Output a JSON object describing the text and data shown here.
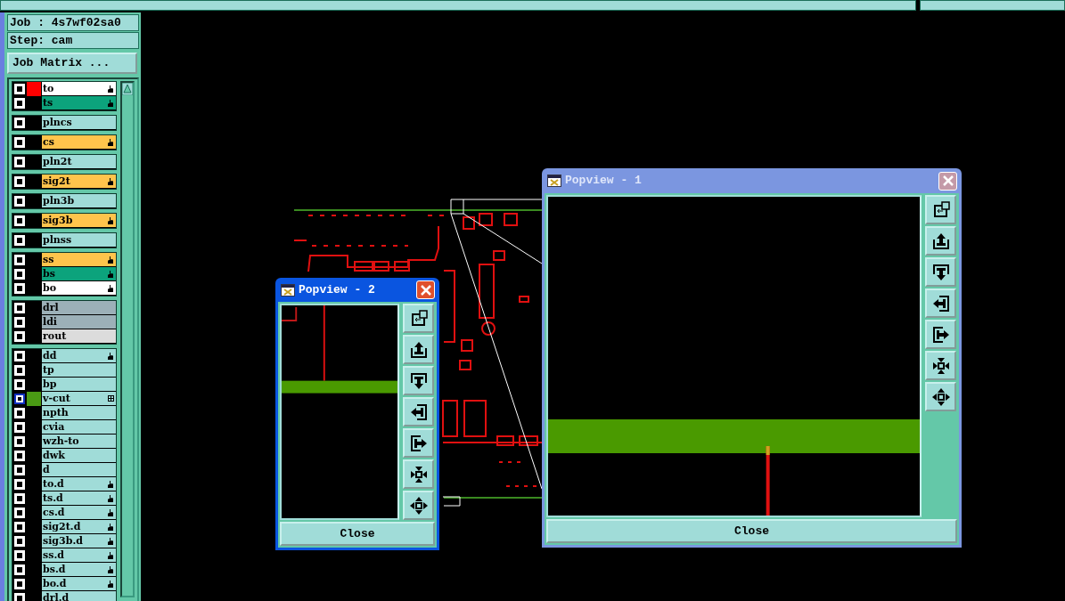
{
  "job_label": "Job : 4s7wf02sa0",
  "step_label": "Step: cam",
  "job_matrix_button": "Job Matrix ...",
  "layer_groups": [
    {
      "layers": [
        {
          "name": "to",
          "color": "#ffffff",
          "swatch": {
            "color": "#ff0000"
          },
          "kind": "hand",
          "selected": false
        },
        {
          "name": "ts",
          "color": "#0ca37c",
          "kind": "hand",
          "selected": false
        }
      ]
    },
    {
      "layers": [
        {
          "name": "plncs",
          "color": "#a0dcd8",
          "kind": "plain",
          "selected": false
        }
      ]
    },
    {
      "layers": [
        {
          "name": "cs",
          "color": "#ffc44c",
          "kind": "hand",
          "selected": false
        }
      ]
    },
    {
      "layers": [
        {
          "name": "pln2t",
          "color": "#a0dcd8",
          "kind": "plain",
          "selected": false
        }
      ]
    },
    {
      "layers": [
        {
          "name": "sig2t",
          "color": "#ffc44c",
          "kind": "hand",
          "selected": false
        }
      ]
    },
    {
      "layers": [
        {
          "name": "pln3b",
          "color": "#a0dcd8",
          "kind": "plain",
          "selected": false
        }
      ]
    },
    {
      "layers": [
        {
          "name": "sig3b",
          "color": "#ffc44c",
          "kind": "hand",
          "selected": false
        }
      ]
    },
    {
      "layers": [
        {
          "name": "plnss",
          "color": "#a0dcd8",
          "kind": "plain",
          "selected": false
        }
      ]
    },
    {
      "layers": [
        {
          "name": "ss",
          "color": "#ffc44c",
          "kind": "hand",
          "selected": false
        },
        {
          "name": "bs",
          "color": "#0ca37c",
          "kind": "hand",
          "selected": false
        },
        {
          "name": "bo",
          "color": "#ffffff",
          "kind": "hand",
          "selected": false
        }
      ]
    },
    {
      "layers": [
        {
          "name": "drl",
          "color": "#9cb0b8",
          "kind": "plain",
          "selected": false
        },
        {
          "name": "ldi",
          "color": "#9cb0b8",
          "kind": "plain",
          "selected": false
        },
        {
          "name": "rout",
          "color": "#dcdcdc",
          "kind": "plain",
          "selected": false
        }
      ]
    },
    {
      "layers": [
        {
          "name": "dd",
          "color": "#a0dcd8",
          "kind": "hand",
          "selected": false
        },
        {
          "name": "tp",
          "color": "#a0dcd8",
          "kind": "plain",
          "selected": false
        },
        {
          "name": "bp",
          "color": "#a0dcd8",
          "kind": "plain",
          "selected": false
        },
        {
          "name": "v-cut",
          "color": "#a0dcd8",
          "swatch": {
            "color": "#4a9a14"
          },
          "kind": "grid",
          "selected": true
        },
        {
          "name": "npth",
          "color": "#a0dcd8",
          "kind": "plain",
          "selected": false
        },
        {
          "name": "cvia",
          "color": "#a0dcd8",
          "kind": "plain",
          "selected": false
        },
        {
          "name": "wzh-to",
          "color": "#a0dcd8",
          "kind": "plain",
          "selected": false
        },
        {
          "name": "dwk",
          "color": "#a0dcd8",
          "kind": "plain",
          "selected": false
        },
        {
          "name": "d",
          "color": "#a0dcd8",
          "kind": "plain",
          "selected": false
        },
        {
          "name": "to.d",
          "color": "#a0dcd8",
          "kind": "hand",
          "selected": false
        },
        {
          "name": "ts.d",
          "color": "#a0dcd8",
          "kind": "hand",
          "selected": false
        },
        {
          "name": "cs.d",
          "color": "#a0dcd8",
          "kind": "hand",
          "selected": false
        },
        {
          "name": "sig2t.d",
          "color": "#a0dcd8",
          "kind": "hand",
          "selected": false
        },
        {
          "name": "sig3b.d",
          "color": "#a0dcd8",
          "kind": "hand",
          "selected": false
        },
        {
          "name": "ss.d",
          "color": "#a0dcd8",
          "kind": "hand",
          "selected": false
        },
        {
          "name": "bs.d",
          "color": "#a0dcd8",
          "kind": "hand",
          "selected": false
        },
        {
          "name": "bo.d",
          "color": "#a0dcd8",
          "kind": "hand",
          "selected": false
        },
        {
          "name": "drl.d",
          "color": "#a0dcd8",
          "kind": "plain",
          "selected": false
        }
      ]
    }
  ],
  "popups": [
    {
      "title": "Popview - 2",
      "active": true,
      "close_button": "Close"
    },
    {
      "title": "Popview - 1",
      "active": false,
      "close_button": "Close"
    }
  ]
}
